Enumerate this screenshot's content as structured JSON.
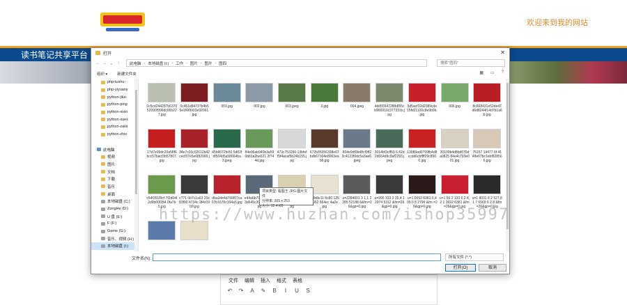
{
  "site": {
    "welcome": "欢迎来到我的网站",
    "nav_title": "读书笔记共享平台",
    "editor_menu": [
      "文件",
      "编辑",
      "插入",
      "格式",
      "表格"
    ],
    "editor_tools": [
      "↶",
      "↷",
      "A",
      "✎",
      "B",
      "I",
      "U",
      "S"
    ]
  },
  "dialog": {
    "title": "打开",
    "path": [
      "此电脑",
      "本地磁盘 (I:)",
      "工作",
      "图片",
      "图片",
      "图四"
    ],
    "search_placeholder": "搜索\"图四\"",
    "toolbar": {
      "organize": "组织 ▾",
      "new_folder": "新建文件夹"
    },
    "sidebar": [
      {
        "label": "php-tushu-",
        "type": "folder"
      },
      {
        "label": "php-yiyuany",
        "type": "folder"
      },
      {
        "label": "python-jiluc",
        "type": "folder"
      },
      {
        "label": "python-ping",
        "type": "folder"
      },
      {
        "label": "python-sixin",
        "type": "folder"
      },
      {
        "label": "python-xuex",
        "type": "folder"
      },
      {
        "label": "python-zaixi",
        "type": "folder"
      },
      {
        "label": "python-zhix",
        "type": "folder"
      },
      {
        "label": "",
        "type": "spacer"
      },
      {
        "label": "此电脑",
        "type": "pc"
      },
      {
        "label": "视频",
        "type": "folder"
      },
      {
        "label": "图片",
        "type": "folder"
      },
      {
        "label": "文档",
        "type": "folder"
      },
      {
        "label": "下载",
        "type": "folder"
      },
      {
        "label": "音乐",
        "type": "folder"
      },
      {
        "label": "桌面",
        "type": "folder"
      },
      {
        "label": "本地磁盘 (C:)",
        "type": "drive"
      },
      {
        "label": "ZongHe (D:)",
        "type": "drive"
      },
      {
        "label": "U 盘 (E:)",
        "type": "drive"
      },
      {
        "label": "F (F:)",
        "type": "drive"
      },
      {
        "label": "Game (G:)",
        "type": "drive"
      },
      {
        "label": "音乐、视频 (H:)",
        "type": "drive"
      },
      {
        "label": "本地磁盘 (I:)",
        "type": "drive",
        "selected": true
      }
    ],
    "files": [
      {
        "name": "0c5cd244287b637052090f996dc00b227.jpg",
        "color": "#b8c0b0"
      },
      {
        "name": "0c451d84737b4b55e1f6f9903e92061.jpg",
        "color": "#7a1e22"
      },
      {
        "name": "001.jpg",
        "color": "#6a8a9a"
      },
      {
        "name": "002.jpg",
        "color": "#8c9aa8"
      },
      {
        "name": "003.jpeg",
        "color": "#5a7a4a"
      },
      {
        "name": "3.jpg",
        "color": "#4a7a3a"
      },
      {
        "name": "004.jpeg",
        "color": "#8a7a6a"
      },
      {
        "name": "4dd555472f8b855cb900910c377331b.jpg",
        "color": "#7a8a6a"
      },
      {
        "name": "5d5acf32d2089cde15fd21100c8e9b0b.jpg",
        "color": "#c8202a"
      },
      {
        "name": "006.jpg",
        "color": "#7aaa6a"
      },
      {
        "name": "8c668431e52de47d6d8244f14d7b1a6b.jpg",
        "color": "#b81e24"
      },
      {
        "name": "17d7e99dc20a58f6bcc57bacf3b57807.jpg",
        "color": "#c41e20"
      },
      {
        "name": "34e7c00c02612b42cecf37e5e6f82999.jpg",
        "color": "#a8222a"
      },
      {
        "name": "45b8672fe50 5d82fdf504d5a58664ba3.jpeg",
        "color": "#2a6a4a"
      },
      {
        "name": "84e06ab940b3a590bb1a2be621 2f744d.jpg",
        "color": "#6a9a5a"
      },
      {
        "name": "473c753266 13bfeff5f4acaf5b24b155.jpg",
        "color": "#d8d8d8"
      },
      {
        "name": "672b35356338e67bdb67304e8063eabb.jpg",
        "color": "#5a3a2a"
      },
      {
        "name": "804e9df3bd8cf9ff23c4123f9dc5a3ae6.jpeg",
        "color": "#6a7a8a"
      },
      {
        "name": "3014bf3cff59 6 42d2d664d9c8af2293.jpeg",
        "color": "#4a6a5a"
      },
      {
        "name": "13089ad0799fb4d8ccdd6cbffff29c8560.jpg",
        "color": "#c82222"
      },
      {
        "name": "30109b4d8bd676da0825 84e4c793e001.jpg",
        "color": "#d8d0c0"
      },
      {
        "name": "75157 14477 6f 4148e67bc1ebf828566.jpg",
        "color": "#d8c8b8"
      },
      {
        "name": "c54f351f9cf 7f2d04f2d9b00f284 0fa7b5.jpg",
        "color": "#6a9a4a"
      },
      {
        "name": "c771 0b7c1a63 20c83f90 4734c 2f4c09b9.jpg",
        "color": "#3a3a3a"
      },
      {
        "name": "dba34e4d766f07ca07b1670c194a5.jpg",
        "color": "#b8222a"
      },
      {
        "name": "e44a6b79773 06e43d645c306d 55e6.jpg",
        "color": "#5a6a7a"
      },
      {
        "name": "f4d3023e3d2 e 0f8300051c2cf6 1e3e.jpg",
        "color": "#d8d0b0"
      },
      {
        "name": "fc9b8e11 8c80 125c9962 864ec 4a2e .jpg",
        "color": "#e8e0d0"
      },
      {
        "name": "u=2284001 3 1,1 2285 52188 8&fm=2 6&gp=0.jpg",
        "color": "#5a5a5a"
      },
      {
        "name": "u=995 333 2 29,4 1 2974 5312 &fm=26&gp=0.jpg",
        "color": "#3a3a3a"
      },
      {
        "name": "u=1 0052 8281 0,4 05 0 8 2796 &fm =26&gp=0.jpg",
        "color": "#2a1a1a"
      },
      {
        "name": "u=1 56 2 130 6 2 4,2 1 3692 6381 &fm =26&gp=0.jpg",
        "color": "#c82030"
      },
      {
        "name": "u=1 8031 8 2 527,8 1 7 6569 6 2 8 &fm=26&gp=0.jpg",
        "color": "#2a2a2a"
      },
      {
        "name": "",
        "color": "#5a7aaa"
      },
      {
        "name": "",
        "color": "#e8e0c8"
      }
    ],
    "tooltip": {
      "line1": "项目类型: 看图王 JPG 图片文件",
      "line2": "分辨率: 305 x 253",
      "line3": "大小: 12.4 KB"
    },
    "filename_label": "文件名(N):",
    "filter": "所有文件 (*.*)",
    "open_label": "打开(O)",
    "cancel_label": "取消"
  },
  "watermark": "https://www.huzhan.com/ishop35997"
}
